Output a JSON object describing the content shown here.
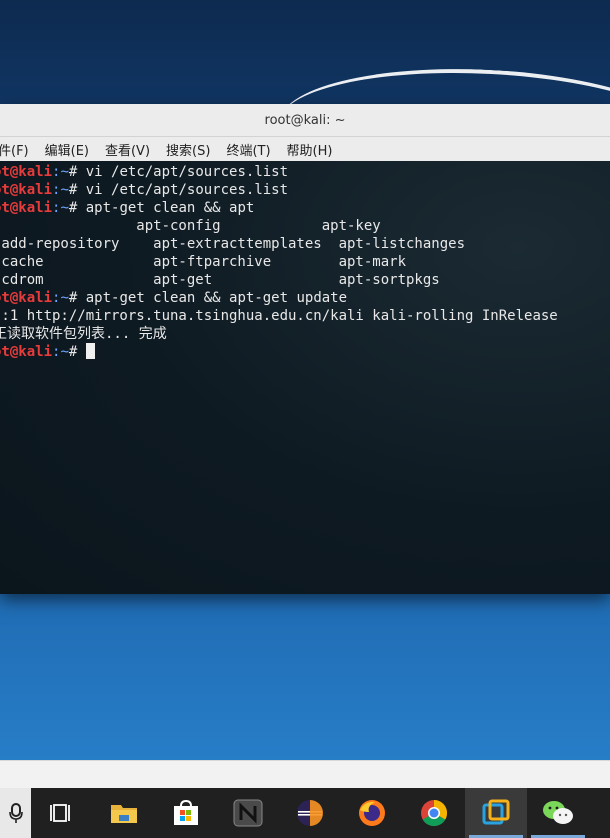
{
  "window": {
    "title": "root@kali: ~"
  },
  "menu": [
    "件(F)",
    "编辑(E)",
    "查看(V)",
    "搜索(S)",
    "终端(T)",
    "帮助(H)"
  ],
  "terminal": {
    "user_host": "ot@kali",
    "prompt_path": ":~",
    "prompt_symbol": "#",
    "commands": [
      "vi /etc/apt/sources.list",
      "vi /etc/apt/sources.list",
      "apt-get clean && apt",
      "apt-get clean && apt-get update",
      ""
    ],
    "completion_rows": [
      "                 apt-config            apt-key",
      "-add-repository    apt-extracttemplates  apt-listchanges",
      "-cache             apt-ftparchive        apt-mark",
      "-cdrom             apt-get               apt-sortpkgs"
    ],
    "output": [
      "':1 http://mirrors.tuna.tsinghua.edu.cn/kali kali-rolling InRelease",
      "正读取软件包列表... 完成"
    ]
  },
  "taskbar": {
    "items": [
      "microphone-icon",
      "task-view-icon",
      "file-explorer-icon",
      "store-icon",
      "n-app-icon",
      "eclipse-icon",
      "firefox-icon",
      "chrome-icon",
      "vmware-icon",
      "wechat-icon"
    ]
  }
}
